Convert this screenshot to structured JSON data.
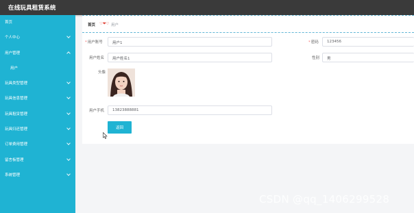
{
  "app": {
    "title": "在线玩具租赁系统"
  },
  "sidebar": {
    "items": [
      {
        "label": "首页",
        "has_children": false
      },
      {
        "label": "个人中心",
        "has_children": true
      },
      {
        "label": "用户管理",
        "has_children": true
      },
      {
        "label": "用户",
        "has_children": false,
        "sub": true
      },
      {
        "label": "玩具类型管理",
        "has_children": true
      },
      {
        "label": "玩具信息管理",
        "has_children": true
      },
      {
        "label": "玩具租赁管理",
        "has_children": true
      },
      {
        "label": "玩具归还管理",
        "has_children": true
      },
      {
        "label": "订单费用管理",
        "has_children": true
      },
      {
        "label": "留言板管理",
        "has_children": true
      },
      {
        "label": "系统管理",
        "has_children": true
      }
    ]
  },
  "breadcrumb": {
    "home": "首页",
    "separator": "♡❤♡",
    "current": "用户"
  },
  "form": {
    "account_label": "用户账号",
    "account_value": "用户1",
    "password_label": "密码",
    "password_value": "123456",
    "name_label": "用户姓名",
    "name_value": "用户姓名1",
    "gender_label": "性别",
    "gender_value": "男",
    "avatar_label": "头像",
    "phone_label": "用户手机",
    "phone_value": "13823888881",
    "required_mark": "*"
  },
  "buttons": {
    "return": "返回"
  },
  "watermark": "CSDN @qq_1406299528",
  "colors": {
    "sidebar": "#1fb3d3",
    "topbar": "#3a3a3a",
    "primary_button": "#1fb3d3",
    "breadcrumb_separator": "#e0453a"
  },
  "icons": {
    "chevron": "chevron-down-icon",
    "cursor": "mouse-pointer-icon"
  }
}
